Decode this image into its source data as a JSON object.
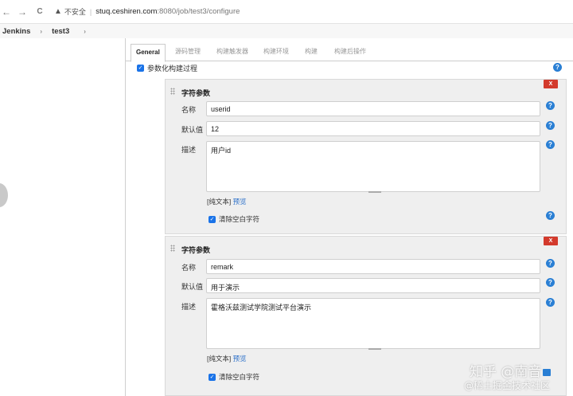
{
  "browser": {
    "back": "←",
    "forward": "→",
    "reload": "C",
    "warning_icon": "▲",
    "insecure_label": "不安全",
    "separator": "|",
    "url_host": "stuq.ceshiren.com",
    "url_path": ":8080/job/test3/configure"
  },
  "breadcrumb": {
    "items": [
      "Jenkins",
      "test3"
    ],
    "arrow": "›"
  },
  "tabs": [
    "General",
    "源码管理",
    "构建触发器",
    "构建环境",
    "构建",
    "构建后操作"
  ],
  "param_toggle": {
    "checked": true,
    "label": "参数化构建过程"
  },
  "help_glyph": "?",
  "checkbox_glyph": "✓",
  "delete_label": "X",
  "params": [
    {
      "title": "字符参数",
      "name_label": "名称",
      "name_value": "userid",
      "default_label": "默认值",
      "default_value": "12",
      "desc_label": "描述",
      "desc_value": "用户id",
      "format_text": "[纯文本]",
      "preview_link": "预览",
      "trim_label": "清除空白字符",
      "trim_checked": true
    },
    {
      "title": "字符参数",
      "name_label": "名称",
      "name_value": "remark",
      "default_label": "默认值",
      "default_value": "用于演示",
      "desc_label": "描述",
      "desc_value": "霍格沃兹测试学院测试平台演示",
      "format_text": "[纯文本]",
      "preview_link": "预览",
      "trim_label": "清除空白字符",
      "trim_checked": true
    }
  ],
  "watermark": {
    "line1": "知乎 @南音",
    "line2": "@稀土掘金技术社区"
  }
}
